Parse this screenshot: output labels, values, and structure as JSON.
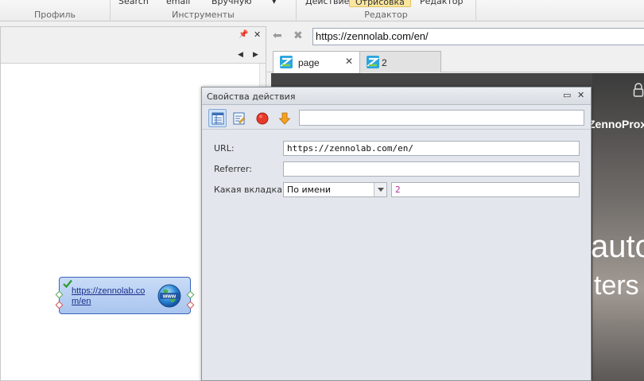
{
  "ribbon": {
    "groups": [
      {
        "label": "Профиль"
      },
      {
        "label": "Инструменты",
        "buttons": [
          "Search",
          "email",
          "Вручную"
        ]
      },
      {
        "label": "Редактор",
        "buttons": [
          "Действие",
          "Отрисовка",
          "Редактор"
        ]
      }
    ],
    "dropdown_glyph": "▾"
  },
  "left_panel": {
    "pin": "📌",
    "close": "✕",
    "nav_left": "◀",
    "nav_right": "▶",
    "node": {
      "link_text": "https://zennolab.com/en",
      "icon_label": "www"
    }
  },
  "browser": {
    "url": "https://zennolab.com/en/",
    "back": "⬅",
    "stop": "✖",
    "tabs": [
      {
        "label": "page",
        "close": "✕"
      },
      {
        "label": "2"
      }
    ],
    "page_texts": {
      "brand": "ZennoProx",
      "headline": "auto",
      "subline": "ters"
    }
  },
  "dialog": {
    "title": "Свойства действия",
    "restore_glyph": "▭",
    "close_glyph": "✕",
    "fields": {
      "url_label": "URL:",
      "url_value": "https://zennolab.com/en/",
      "referrer_label": "Referrer:",
      "referrer_value": "",
      "tab_label": "Какая вкладка:",
      "tab_mode": "По имени",
      "tab_name": "2"
    },
    "colors": {
      "tab_name_text": "#b0309a",
      "accent_blue": "#3a63b8"
    }
  }
}
